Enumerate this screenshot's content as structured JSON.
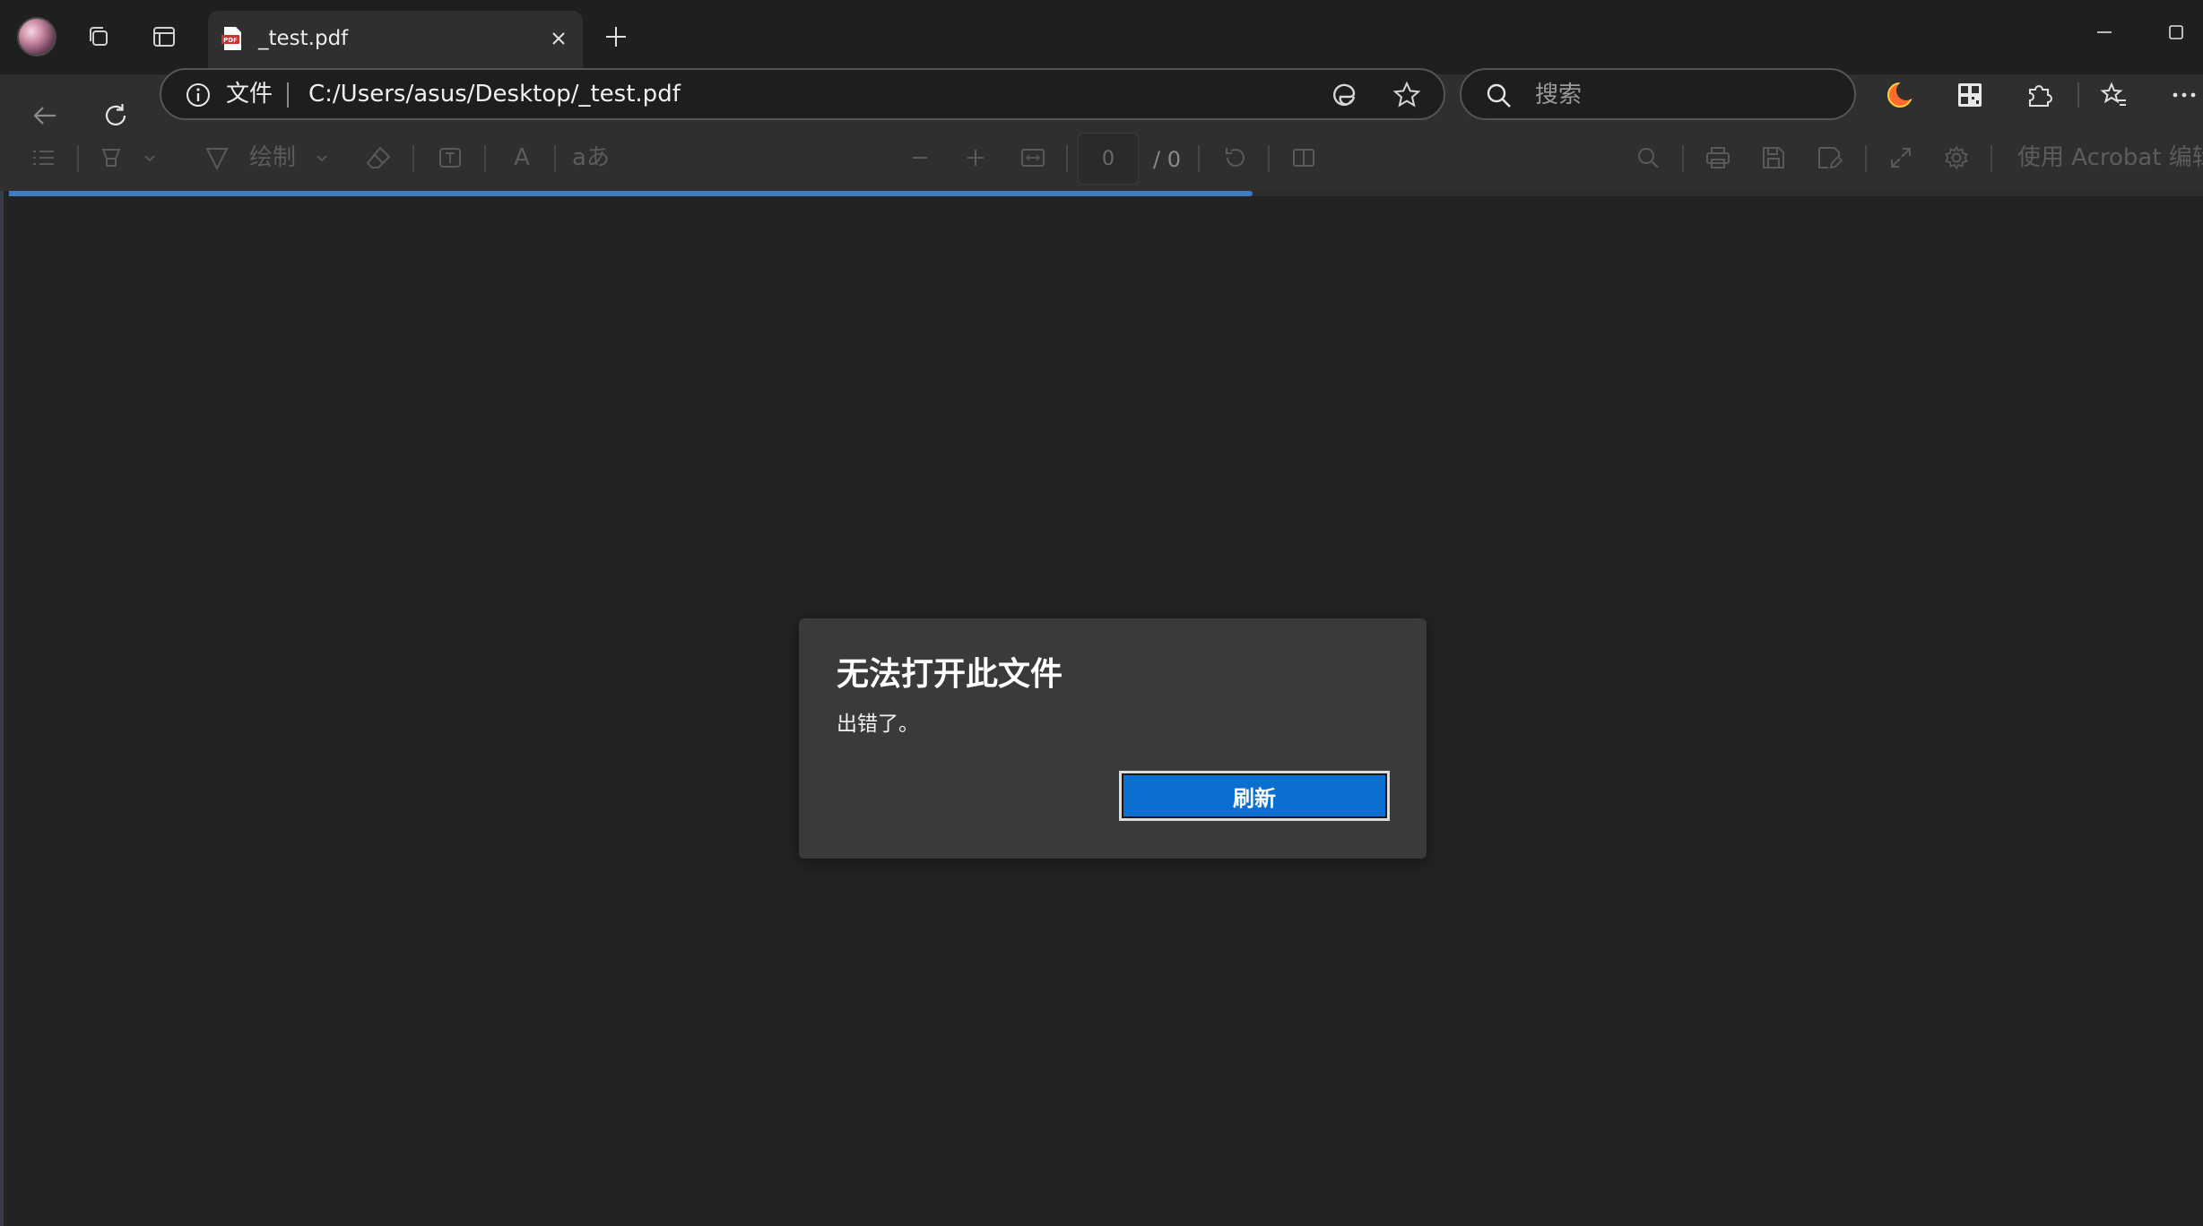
{
  "tab": {
    "title": "_test.pdf",
    "favicon_label": "PDF"
  },
  "address_bar": {
    "scheme_label": "文件",
    "url": "C:/Users/asus/Desktop/_test.pdf"
  },
  "search": {
    "placeholder": "搜索"
  },
  "pdf_toolbar": {
    "draw_label": "绘制",
    "text_size_label": "A",
    "read_aloud_label": "aあ",
    "page_current": "0",
    "page_total": "/ 0",
    "edit_in_acrobat_label": "使用 Acrobat 编辑"
  },
  "progress": {
    "fraction": 0.567
  },
  "dialog": {
    "title": "无法打开此文件",
    "message": "出错了。",
    "button_label": "刷新"
  },
  "colors": {
    "accent": "#0a6fd0",
    "progress": "#3f7cc1",
    "background": "#232323"
  }
}
